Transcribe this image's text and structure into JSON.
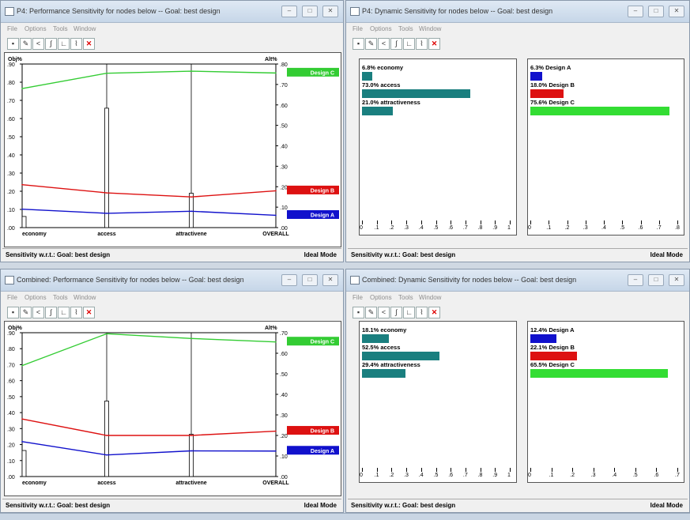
{
  "menus": [
    "File",
    "Options",
    "Tools",
    "Window"
  ],
  "status_left": "Sensitivity w.r.t.: Goal: best design",
  "status_right": "Ideal Mode",
  "windows": [
    {
      "id": "p4-perf",
      "title": "P4: Performance Sensitivity for nodes below -- Goal: best design",
      "type": "performance",
      "left_axis_label": "Obj%",
      "right_axis_label": "Alt%",
      "left_ticks": [
        ".90",
        ".80",
        ".70",
        ".60",
        ".50",
        ".40",
        ".30",
        ".20",
        ".10",
        ".00"
      ],
      "right_ticks": [
        ".80",
        ".70",
        ".60",
        ".50",
        ".40",
        ".30",
        ".20",
        ".10",
        ".00"
      ],
      "categories": [
        "economy",
        "access",
        "attractivene",
        "OVERALL"
      ],
      "objective_bars": [
        0.068,
        0.73,
        0.21
      ],
      "chart_data": {
        "type": "line",
        "categories": [
          "economy",
          "access",
          "attractiveness",
          "OVERALL"
        ],
        "left_axis": {
          "label": "Obj%",
          "ylim": [
            0,
            1.0
          ]
        },
        "right_axis": {
          "label": "Alt%",
          "ylim": [
            0,
            0.8
          ]
        },
        "objective_bars": {
          "economy": 0.068,
          "access": 0.73,
          "attractiveness": 0.21
        },
        "series": [
          {
            "name": "Design C",
            "color": "#33cc33",
            "values": [
              0.68,
              0.755,
              0.765,
              0.756
            ]
          },
          {
            "name": "Design B",
            "color": "#dd1111",
            "values": [
              0.21,
              0.17,
              0.15,
              0.18
            ]
          },
          {
            "name": "Design A",
            "color": "#1111cc",
            "values": [
              0.09,
              0.07,
              0.08,
              0.06
            ]
          }
        ]
      }
    },
    {
      "id": "p4-dyn",
      "title": "P4: Dynamic Sensitivity for nodes below -- Goal: best design",
      "type": "dynamic",
      "left_ticks": [
        "0",
        ".1",
        ".2",
        ".3",
        ".4",
        ".5",
        ".6",
        ".7",
        ".8",
        ".9",
        "1"
      ],
      "right_ticks": [
        "0",
        ".1",
        ".2",
        ".3",
        ".4",
        ".5",
        ".6",
        ".7",
        ".8"
      ],
      "chart_data": {
        "type": "bar",
        "objectives": [
          {
            "label": "6.8% economy",
            "value": 0.068
          },
          {
            "label": "73.0% access",
            "value": 0.73
          },
          {
            "label": "21.0% attractiveness",
            "value": 0.21
          }
        ],
        "objectives_xlim": [
          0,
          1
        ],
        "alternatives": [
          {
            "label": "6.3% Design A",
            "value": 0.063,
            "color": "#1111cc"
          },
          {
            "label": "18.0% Design B",
            "value": 0.18,
            "color": "#dd1111"
          },
          {
            "label": "75.6% Design C",
            "value": 0.756,
            "color": "#33dd33"
          }
        ],
        "alternatives_xlim": [
          0,
          0.8
        ]
      }
    },
    {
      "id": "comb-perf",
      "title": "Combined: Performance Sensitivity for nodes below -- Goal: best design",
      "type": "performance",
      "left_axis_label": "Obj%",
      "right_axis_label": "Alt%",
      "left_ticks": [
        ".90",
        ".80",
        ".70",
        ".60",
        ".50",
        ".40",
        ".30",
        ".20",
        ".10",
        ".00"
      ],
      "right_ticks": [
        ".70",
        ".60",
        ".50",
        ".40",
        ".30",
        ".20",
        ".10",
        ".00"
      ],
      "categories": [
        "economy",
        "access",
        "attractivene",
        "OVERALL"
      ],
      "objective_bars": [
        0.181,
        0.525,
        0.294
      ],
      "chart_data": {
        "type": "line",
        "categories": [
          "economy",
          "access",
          "attractiveness",
          "OVERALL"
        ],
        "left_axis": {
          "label": "Obj%",
          "ylim": [
            0,
            1.0
          ]
        },
        "right_axis": {
          "label": "Alt%",
          "ylim": [
            0,
            0.7
          ]
        },
        "objective_bars": {
          "economy": 0.181,
          "access": 0.525,
          "attractiveness": 0.294
        },
        "series": [
          {
            "name": "Design C",
            "color": "#33cc33",
            "values": [
              0.54,
              0.695,
              0.672,
              0.655
            ]
          },
          {
            "name": "Design B",
            "color": "#dd1111",
            "values": [
              0.28,
              0.2,
              0.2,
              0.221
            ]
          },
          {
            "name": "Design A",
            "color": "#1111cc",
            "values": [
              0.17,
              0.105,
              0.125,
              0.124
            ]
          }
        ]
      }
    },
    {
      "id": "comb-dyn",
      "title": "Combined: Dynamic Sensitivity for nodes below -- Goal: best design",
      "type": "dynamic",
      "left_ticks": [
        "0",
        ".1",
        ".2",
        ".3",
        ".4",
        ".5",
        ".6",
        ".7",
        ".8",
        ".9",
        "1"
      ],
      "right_ticks": [
        "0",
        ".1",
        ".2",
        ".3",
        ".4",
        ".5",
        ".6",
        ".7"
      ],
      "chart_data": {
        "type": "bar",
        "objectives": [
          {
            "label": "18.1% economy",
            "value": 0.181
          },
          {
            "label": "52.5% access",
            "value": 0.525
          },
          {
            "label": "29.4% attractiveness",
            "value": 0.294
          }
        ],
        "objectives_xlim": [
          0,
          1
        ],
        "alternatives": [
          {
            "label": "12.4% Design A",
            "value": 0.124,
            "color": "#1111cc"
          },
          {
            "label": "22.1% Design B",
            "value": 0.221,
            "color": "#dd1111"
          },
          {
            "label": "65.5% Design C",
            "value": 0.655,
            "color": "#33dd33"
          }
        ],
        "alternatives_xlim": [
          0,
          0.7
        ]
      }
    }
  ]
}
